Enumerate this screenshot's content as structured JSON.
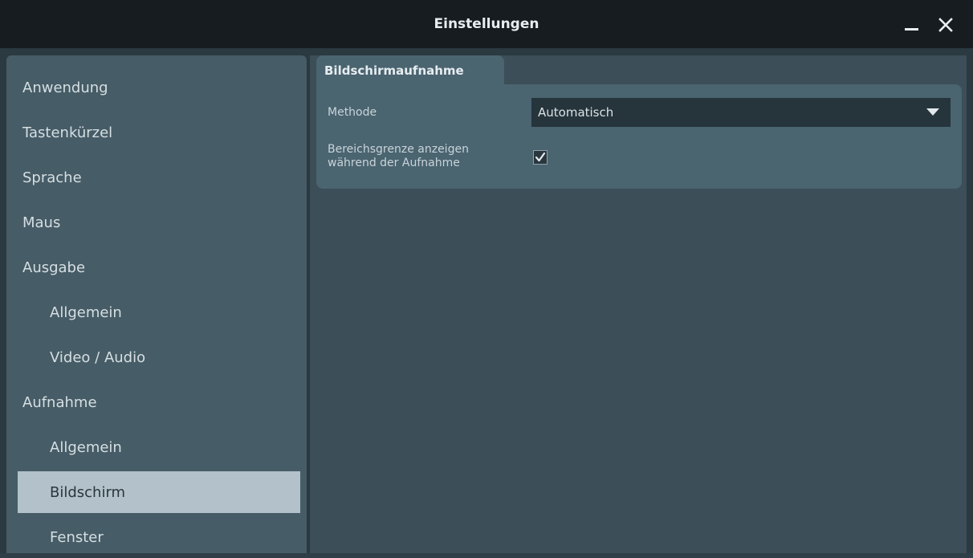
{
  "window": {
    "title": "Einstellungen",
    "minimize_icon": "minimize-icon",
    "close_icon": "close-icon"
  },
  "sidebar": {
    "items": [
      {
        "label": "Anwendung",
        "sub": false,
        "active": false
      },
      {
        "label": "Tastenkürzel",
        "sub": false,
        "active": false
      },
      {
        "label": "Sprache",
        "sub": false,
        "active": false
      },
      {
        "label": "Maus",
        "sub": false,
        "active": false
      },
      {
        "label": "Ausgabe",
        "sub": false,
        "active": false
      },
      {
        "label": "Allgemein",
        "sub": true,
        "active": false
      },
      {
        "label": "Video / Audio",
        "sub": true,
        "active": false
      },
      {
        "label": "Aufnahme",
        "sub": false,
        "active": false
      },
      {
        "label": "Allgemein",
        "sub": true,
        "active": false
      },
      {
        "label": "Bildschirm",
        "sub": true,
        "active": true
      },
      {
        "label": "Fenster",
        "sub": true,
        "active": false
      }
    ]
  },
  "main": {
    "tab_label": "Bildschirmaufnahme",
    "method_label": "Methode",
    "method_value": "Automatisch",
    "border_label_line1": "Bereichsgrenze anzeigen",
    "border_label_line2": "während der Aufnahme",
    "border_checked": true
  },
  "colors": {
    "titlebar": "#161c20",
    "sidebar": "#465c66",
    "active_item": "#b3c2ca",
    "panel": "#4a6470",
    "content": "#3c4e58"
  }
}
